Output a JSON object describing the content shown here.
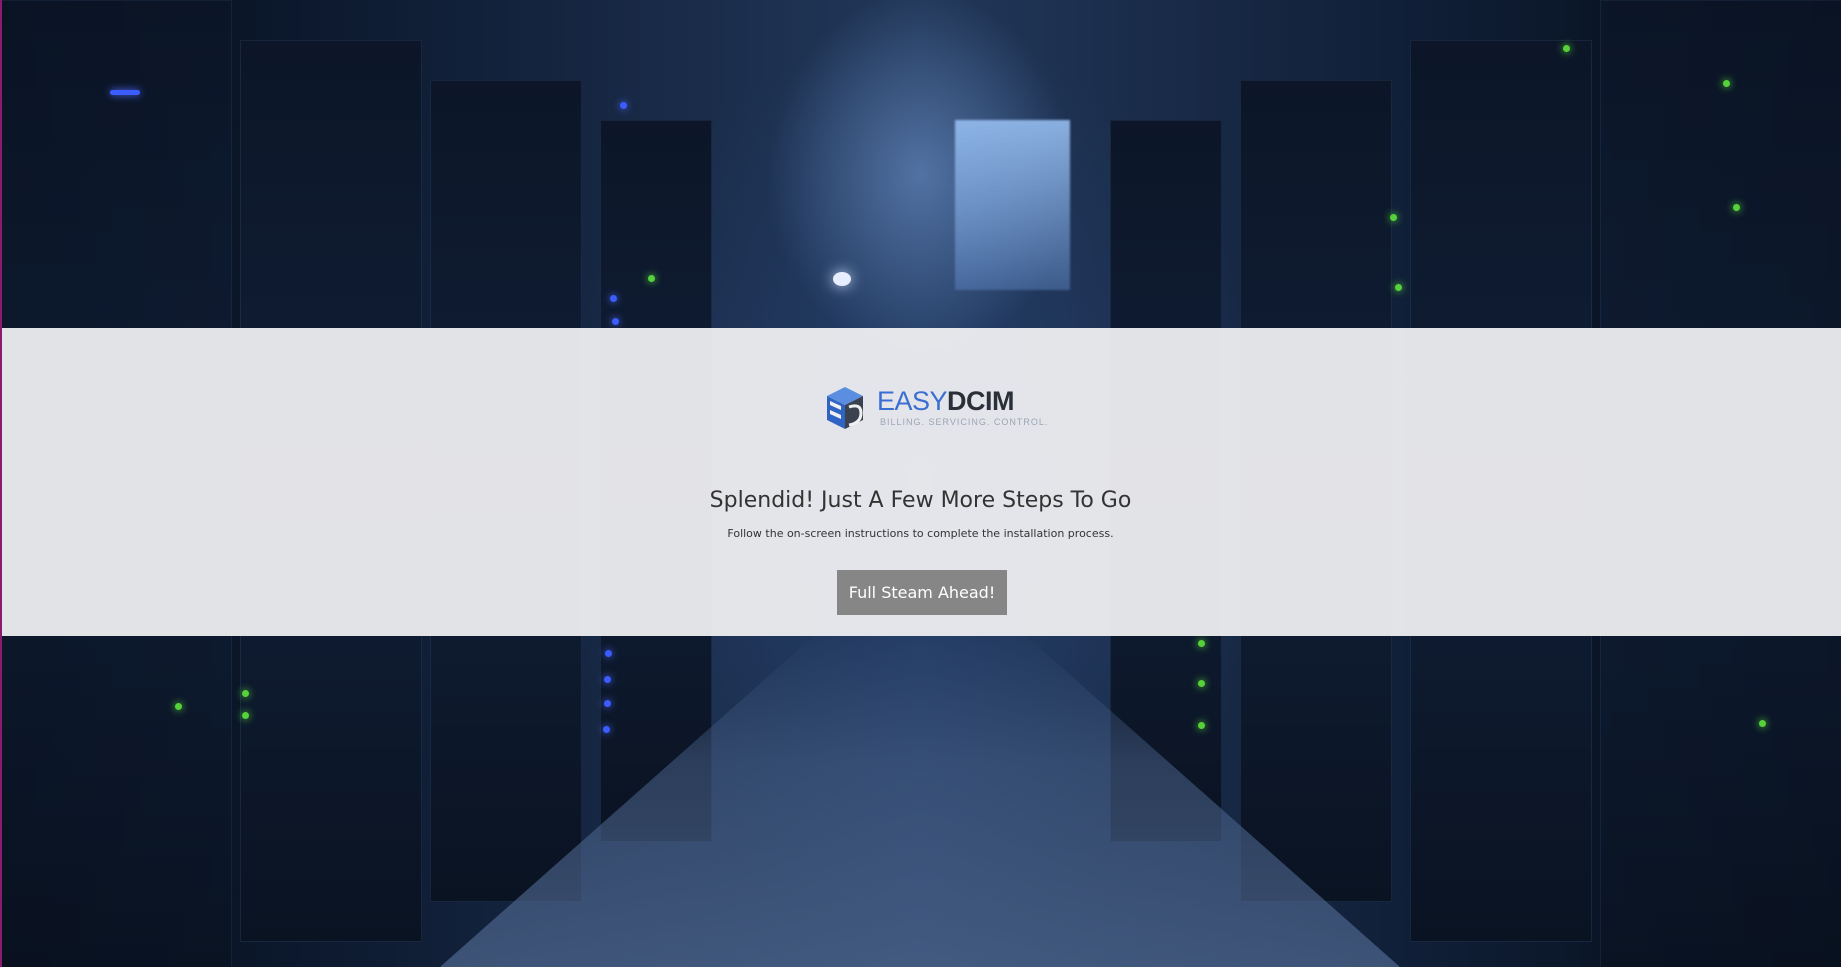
{
  "logo": {
    "word_part1": "EASY",
    "word_part2": "DCIM",
    "tagline": "BILLING. SERVICING. CONTROL.",
    "icon": "easydcim-cube-icon",
    "colors": {
      "primary": "#3a6fd1",
      "dark": "#2a2f3a"
    }
  },
  "main": {
    "heading": "Splendid! Just A Few More Steps To Go",
    "subtext": "Follow the on-screen instructions to complete the installation process.",
    "button_label": "Full Steam Ahead!"
  },
  "colors": {
    "band": "#f0f0f2",
    "button": "#868686",
    "accent_edge": "#8a1b6e"
  }
}
